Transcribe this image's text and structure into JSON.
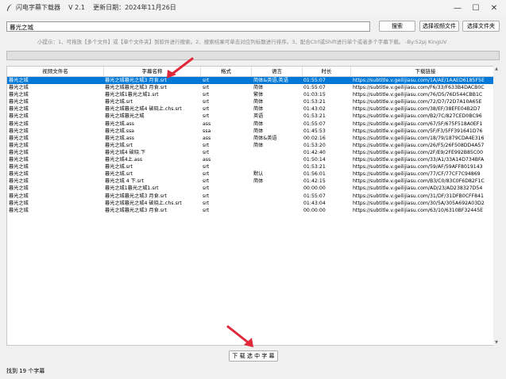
{
  "window": {
    "title": "闪电字幕下载器    V 2.1    更新日期：2024年11月26日",
    "minimize_icon": "minimize-icon",
    "maximize_icon": "maximize-icon",
    "close_icon": "close-icon"
  },
  "search": {
    "value": "暮光之城",
    "button_label": "搜索",
    "select_video_label": "选择视频文件",
    "select_folder_label": "选择文件夹"
  },
  "hint": "小提示：1、可拖放【多个文件】或【单个文件夹】到软件进行搜索。2、搜索结果可单击对应列标题进行排序。3、配合Ctrl或Shift进行单个或者多个字幕下载。 -By:52pj KingUV",
  "progress": {
    "value": 0
  },
  "table": {
    "columns": [
      "视频文件名",
      "字幕名称",
      "格式",
      "语言",
      "时长",
      "下载链接"
    ],
    "rows": [
      [
        "暮光之城",
        "暮光之城暮光之城3 月食.srt",
        "srt",
        "简体&英语,英语",
        "01:55:07",
        "https://subtitle.v.geilijiasu.com/1A/AE/1AAED6185F5E",
        true
      ],
      [
        "暮光之城",
        "暮光之城暮光之城3 月食.srt",
        "srt",
        "简体",
        "01:55:07",
        "https://subtitle.v.geilijiasu.com/F6/33/F633B4DACB0C",
        false
      ],
      [
        "暮光之城",
        "暮光之城1暮光之城1.srt",
        "srt",
        "繁体",
        "01:03:15",
        "https://subtitle.v.geilijiasu.com/76/D5/76D544CBB1C",
        false
      ],
      [
        "暮光之城",
        "暮光之城.srt",
        "srt",
        "简体",
        "01:53:21",
        "https://subtitle.v.geilijiasu.com/72/D7/72D7A10A65E",
        false
      ],
      [
        "暮光之城",
        "暮光之城暮光之城4 破晓上.chs.srt",
        "srt",
        "简体",
        "01:43:02",
        "https://subtitle.v.geilijiasu.com/38/EF/38EFE04B2D7",
        false
      ],
      [
        "暮光之城",
        "暮光之城暮光之城",
        "srt",
        "英语",
        "01:53:21",
        "https://subtitle.v.geilijiasu.com/B2/7C/827CED0BC96",
        false
      ],
      [
        "暮光之城",
        "暮光之城.ass",
        "ass",
        "简体",
        "01:55:07",
        "https://subtitle.v.geilijiasu.com/67/5F/675F518A0EF1",
        false
      ],
      [
        "暮光之城",
        "暮光之城.ssa",
        "ssa",
        "简体",
        "01:45:53",
        "https://subtitle.v.geilijiasu.com/5F/F3/5FF391641D76",
        false
      ],
      [
        "暮光之城",
        "暮光之城.ass",
        "ass",
        "简体&英语",
        "00:02:16",
        "https://subtitle.v.geilijiasu.com/18/79/1879CDA4E316",
        false
      ],
      [
        "暮光之城",
        "暮光之城.srt",
        "srt",
        "简体",
        "01:53:20",
        "https://subtitle.v.geilijiasu.com/26/F5/26F508DD4A57",
        false
      ],
      [
        "暮光之城",
        "暮光之城4 破晓.下",
        "srt",
        "",
        "01:42:40",
        "https://subtitle.v.geilijiasu.com/2F/E9/2FE992B85C00",
        false
      ],
      [
        "暮光之城",
        "暮光之城4上.ass",
        "ass",
        "",
        "01:50:14",
        "https://subtitle.v.geilijiasu.com/33/A1/33A14D734BFA",
        false
      ],
      [
        "暮光之城",
        "暮光之城.srt",
        "srt",
        "",
        "01:53:21",
        "https://subtitle.v.geilijiasu.com/59/AF/59AFF8019143",
        false
      ],
      [
        "暮光之城",
        "暮光之城.srt",
        "srt",
        "默认",
        "01:56:01",
        "https://subtitle.v.geilijiasu.com/77/CF/77CF7C94869",
        false
      ],
      [
        "暮光之城",
        "暮光之城 4 下.srt",
        "srt",
        "简体",
        "01:42:15",
        "https://subtitle.v.geilijiasu.com/B3/C0/83C0F6D82F1C",
        false
      ],
      [
        "暮光之城",
        "暮光之城1暮光之城1.srt",
        "srt",
        "",
        "00:00:00",
        "https://subtitle.v.geilijiasu.com/AD/23/AD238327D54",
        false
      ],
      [
        "暮光之城",
        "暮光之城暮光之城3 月食.srt",
        "srt",
        "",
        "01:55:07",
        "https://subtitle.v.geilijiasu.com/31/DF/31DFB0CFF841",
        false
      ],
      [
        "暮光之城",
        "暮光之城暮光之城4 破晓上.chs.srt",
        "srt",
        "",
        "01:43:04",
        "https://subtitle.v.geilijiasu.com/30/5A/305A692A03D2",
        false
      ],
      [
        "暮光之城",
        "暮光之城暮光之城3 月食.srt",
        "srt",
        "",
        "00:00:00",
        "https://subtitle.v.geilijiasu.com/63/10/6310BF32445E",
        false
      ]
    ]
  },
  "download_button": "下 载 选 中 字 幕",
  "status": "找到 19 个字幕",
  "colors": {
    "selected_row": "#0078d7",
    "arrow": "#e0283a"
  }
}
